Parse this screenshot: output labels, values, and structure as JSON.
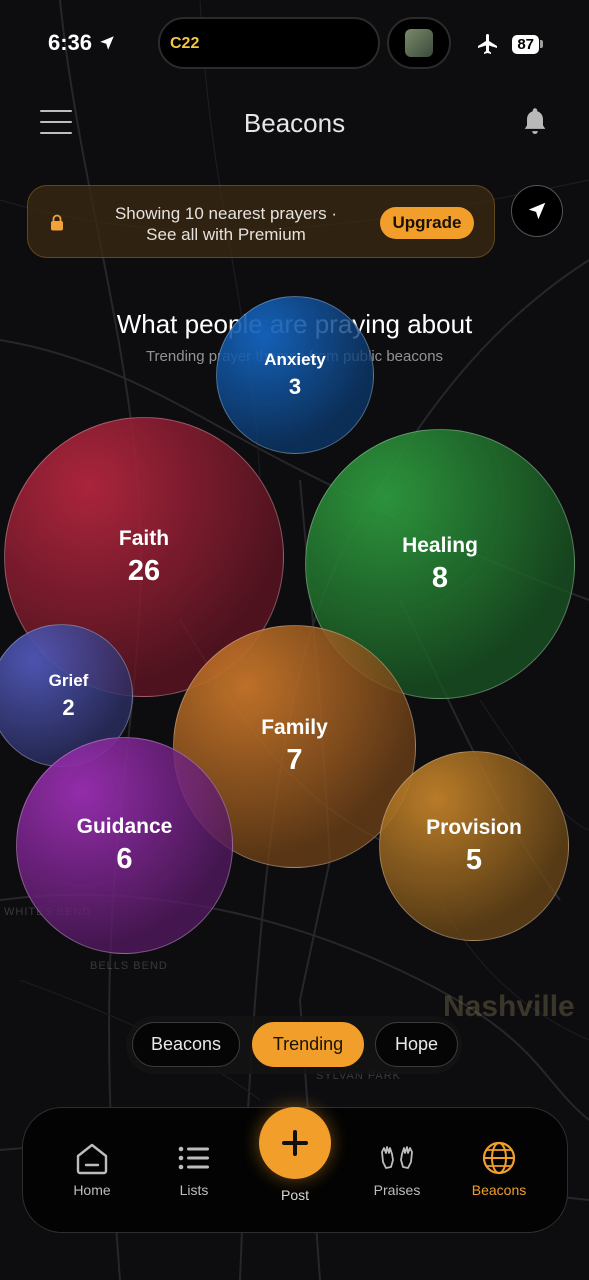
{
  "status_bar": {
    "time": "6:36",
    "island_label": "C22",
    "battery": "87"
  },
  "header": {
    "title": "Beacons",
    "menu_icon": "hamburger-icon",
    "notification_icon": "bell-icon"
  },
  "banner": {
    "line1": "Showing 10 nearest prayers ·",
    "line2": "See all with Premium",
    "upgrade_label": "Upgrade",
    "icon": "lock-icon"
  },
  "trending": {
    "title": "What people are praying about",
    "subtitle": "Trending prayer themes from public beacons"
  },
  "bubbles": [
    {
      "label": "Anxiety",
      "count": "3",
      "color": "#1565c0"
    },
    {
      "label": "Faith",
      "count": "26",
      "color": "#b3263f"
    },
    {
      "label": "Healing",
      "count": "8",
      "color": "#2e9a3e"
    },
    {
      "label": "Grief",
      "count": "2",
      "color": "#5158b8"
    },
    {
      "label": "Family",
      "count": "7",
      "color": "#c8762a"
    },
    {
      "label": "Guidance",
      "count": "6",
      "color": "#9b2fb3"
    },
    {
      "label": "Provision",
      "count": "5",
      "color": "#c2822a"
    }
  ],
  "segments": {
    "tabs": [
      "Beacons",
      "Trending",
      "Hope"
    ],
    "active": "Trending"
  },
  "map": {
    "city": "Nashville",
    "labels": [
      "WHITES BEND",
      "BELLS BEND",
      "SYLVAN PARK"
    ]
  },
  "nav": {
    "items": [
      {
        "label": "Home",
        "icon": "home-icon"
      },
      {
        "label": "Lists",
        "icon": "list-icon"
      },
      {
        "label": "Post",
        "icon": "plus-icon"
      },
      {
        "label": "Praises",
        "icon": "praise-hands-icon"
      },
      {
        "label": "Beacons",
        "icon": "globe-icon"
      }
    ],
    "active": "Beacons"
  },
  "colors": {
    "accent": "#f29e2a",
    "background": "#0b0b0d"
  }
}
